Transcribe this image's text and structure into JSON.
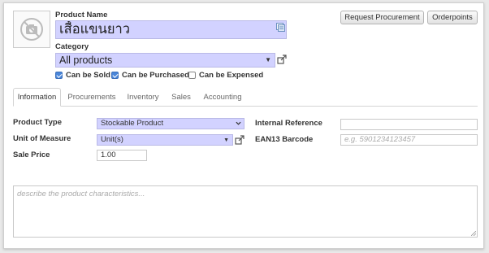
{
  "product": {
    "name_label": "Product Name",
    "name_value": "เสื้อแขนยาว",
    "category_label": "Category",
    "category_value": "All products"
  },
  "options": {
    "can_be_sold": {
      "label": "Can be Sold",
      "checked": true
    },
    "can_be_purchased": {
      "label": "Can be Purchased",
      "checked": true
    },
    "can_be_expensed": {
      "label": "Can be Expensed",
      "checked": false
    }
  },
  "buttons": {
    "request_procurement": "Request Procurement",
    "orderpoints": "Orderpoints"
  },
  "tabs": [
    {
      "label": "Information",
      "active": true
    },
    {
      "label": "Procurements",
      "active": false
    },
    {
      "label": "Inventory",
      "active": false
    },
    {
      "label": "Sales",
      "active": false
    },
    {
      "label": "Accounting",
      "active": false
    }
  ],
  "info": {
    "product_type_label": "Product Type",
    "product_type_value": "Stockable Product",
    "uom_label": "Unit of Measure",
    "uom_value": "Unit(s)",
    "sale_price_label": "Sale Price",
    "sale_price_value": "1.00",
    "internal_ref_label": "Internal Reference",
    "internal_ref_value": "",
    "ean13_label": "EAN13 Barcode",
    "ean13_placeholder": "e.g. 5901234123457"
  },
  "description": {
    "placeholder": "describe the product characteristics..."
  },
  "colors": {
    "required_field_bg": "#d2d2ff",
    "checkbox_accent": "#4a86d9"
  },
  "icons": {
    "product_image": "camera-placeholder-icon",
    "external_link": "external-link-icon",
    "dropdown": "chevron-down-icon"
  }
}
